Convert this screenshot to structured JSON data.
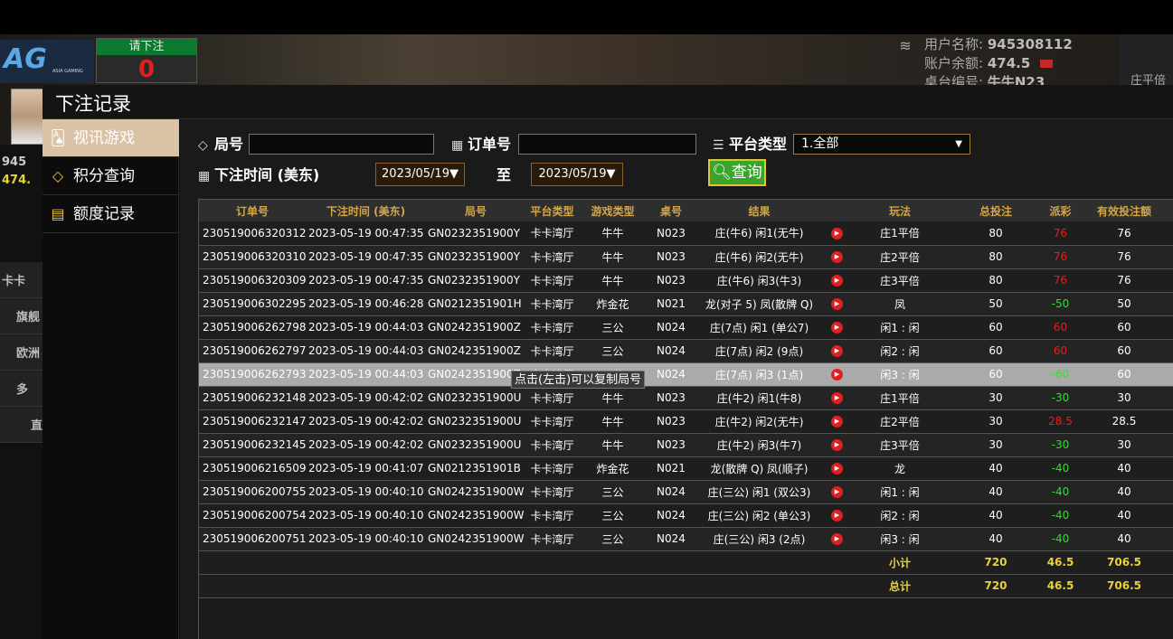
{
  "background": {
    "logo": {
      "text": "AG",
      "subtext": "ASIA GAMING"
    },
    "bet_panel": {
      "title": "请下注",
      "value": "0"
    },
    "user": {
      "name_label": "用户名称:",
      "name_value": "945308112",
      "balance_label": "账户余额:",
      "balance_value": "474.5",
      "table_label": "桌台编号:",
      "table_value": "牛牛N23"
    },
    "right_panel_text": "庄平倍",
    "side_strip": [
      "945",
      "474.",
      "卡卡",
      "旗舰",
      "欧洲",
      "多",
      "直"
    ]
  },
  "modal": {
    "title": "下注记录",
    "nav": [
      {
        "label": "视讯游戏",
        "icon": "playing-cards-icon"
      },
      {
        "label": "积分查询",
        "icon": "diamond-icon"
      },
      {
        "label": "额度记录",
        "icon": "document-icon"
      }
    ],
    "filters": {
      "round_label": "局号",
      "round_value": "",
      "order_label": "订单号",
      "order_value": "",
      "platform_label": "平台类型",
      "platform_value": "1.全部",
      "time_label": "下注时间 (美东)",
      "date_from": "2023/05/19▼",
      "to_label": "至",
      "date_to": "2023/05/19▼",
      "query_label": "查询"
    },
    "table": {
      "headers": [
        "订单号",
        "下注时间 (美东)",
        "局号",
        "平台类型",
        "游戏类型",
        "桌号",
        "结果",
        "",
        "玩法",
        "总投注",
        "派彩",
        "有效投注额",
        ""
      ],
      "rows": [
        [
          "230519006320312",
          "2023-05-19 00:47:35",
          "GN0232351900Y",
          "卡卡湾厅",
          "牛牛",
          "N023",
          "庄(牛6) 闲1(无牛)",
          "▶",
          "庄1平倍",
          "80",
          "76",
          "76",
          "i"
        ],
        [
          "230519006320310",
          "2023-05-19 00:47:35",
          "GN0232351900Y",
          "卡卡湾厅",
          "牛牛",
          "N023",
          "庄(牛6) 闲2(无牛)",
          "▶",
          "庄2平倍",
          "80",
          "76",
          "76",
          "i"
        ],
        [
          "230519006320309",
          "2023-05-19 00:47:35",
          "GN0232351900Y",
          "卡卡湾厅",
          "牛牛",
          "N023",
          "庄(牛6) 闲3(牛3)",
          "▶",
          "庄3平倍",
          "80",
          "76",
          "76",
          "i"
        ],
        [
          "230519006302295",
          "2023-05-19 00:46:28",
          "GN0212351901H",
          "卡卡湾厅",
          "炸金花",
          "N021",
          "龙(对子 5) 凤(散牌 Q)",
          "▶",
          "凤",
          "50",
          "-50",
          "50",
          "i"
        ],
        [
          "230519006262798",
          "2023-05-19 00:44:03",
          "GN0242351900Z",
          "卡卡湾厅",
          "三公",
          "N024",
          "庄(7点) 闲1 (单公7)",
          "▶",
          "闲1 : 闲",
          "60",
          "60",
          "60",
          "i"
        ],
        [
          "230519006262797",
          "2023-05-19 00:44:03",
          "GN0242351900Z",
          "卡卡湾厅",
          "三公",
          "N024",
          "庄(7点) 闲2 (9点)",
          "▶",
          "闲2 : 闲",
          "60",
          "60",
          "60",
          "i"
        ],
        [
          "230519006262793",
          "2023-05-19 00:44:03",
          "GN0242351900Z",
          "卡卡湾厅",
          "三公",
          "N024",
          "庄(7点) 闲3 (1点)",
          "▶",
          "闲3 : 闲",
          "60",
          "-60",
          "60",
          "i"
        ],
        [
          "230519006232148",
          "2023-05-19 00:42:02",
          "GN0232351900U",
          "卡卡湾厅",
          "牛牛",
          "N023",
          "庄(牛2) 闲1(牛8)",
          "▶",
          "庄1平倍",
          "30",
          "-30",
          "30",
          "i"
        ],
        [
          "230519006232147",
          "2023-05-19 00:42:02",
          "GN0232351900U",
          "卡卡湾厅",
          "牛牛",
          "N023",
          "庄(牛2) 闲2(无牛)",
          "▶",
          "庄2平倍",
          "30",
          "28.5",
          "28.5",
          "i"
        ],
        [
          "230519006232145",
          "2023-05-19 00:42:02",
          "GN0232351900U",
          "卡卡湾厅",
          "牛牛",
          "N023",
          "庄(牛2) 闲3(牛7)",
          "▶",
          "庄3平倍",
          "30",
          "-30",
          "30",
          "i"
        ],
        [
          "230519006216509",
          "2023-05-19 00:41:07",
          "GN0212351901B",
          "卡卡湾厅",
          "炸金花",
          "N021",
          "龙(散牌 Q) 凤(顺子)",
          "▶",
          "龙",
          "40",
          "-40",
          "40",
          "i"
        ],
        [
          "230519006200755",
          "2023-05-19 00:40:10",
          "GN0242351900W",
          "卡卡湾厅",
          "三公",
          "N024",
          "庄(三公) 闲1 (双公3)",
          "▶",
          "闲1 : 闲",
          "40",
          "-40",
          "40",
          "i"
        ],
        [
          "230519006200754",
          "2023-05-19 00:40:10",
          "GN0242351900W",
          "卡卡湾厅",
          "三公",
          "N024",
          "庄(三公) 闲2 (单公3)",
          "▶",
          "闲2 : 闲",
          "40",
          "-40",
          "40",
          "i"
        ],
        [
          "230519006200751",
          "2023-05-19 00:40:10",
          "GN0242351900W",
          "卡卡湾厅",
          "三公",
          "N024",
          "庄(三公) 闲3 (2点)",
          "▶",
          "闲3 : 闲",
          "40",
          "-40",
          "40",
          "i"
        ]
      ],
      "subtotal": {
        "label": "小计",
        "bet": "720",
        "payout": "46.5",
        "valid": "706.5"
      },
      "total": {
        "label": "总计",
        "bet": "720",
        "payout": "46.5",
        "valid": "706.5"
      },
      "highlight_row_index": 6,
      "tooltip": "点击(左击)可以复制局号"
    }
  },
  "colors": {
    "header_text": "#d4a64a",
    "negative": "#3ad83a",
    "positive": "#e02020",
    "summary": "#e8d23a",
    "nav_active": "#d9c3a4",
    "query_button": "#3aa52c"
  }
}
